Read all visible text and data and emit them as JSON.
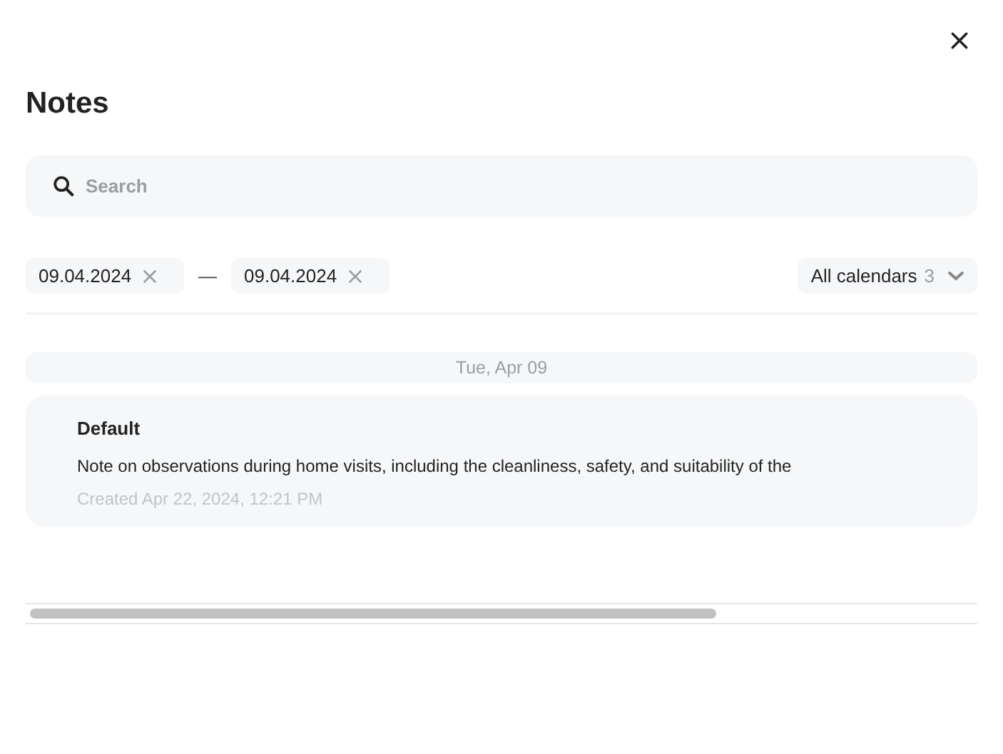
{
  "title": "Notes",
  "search": {
    "placeholder": "Search"
  },
  "date_from": "09.04.2024",
  "date_separator": "—",
  "date_to": "09.04.2024",
  "calendar_filter": {
    "label": "All calendars",
    "count": "3"
  },
  "groups": [
    {
      "date": "Tue, Apr 09",
      "notes": [
        {
          "calendar": "Default",
          "text": "Note on observations during home visits, including the cleanliness, safety, and suitability of the",
          "created": "Created Apr 22, 2024, 12:21 PM"
        }
      ]
    }
  ]
}
